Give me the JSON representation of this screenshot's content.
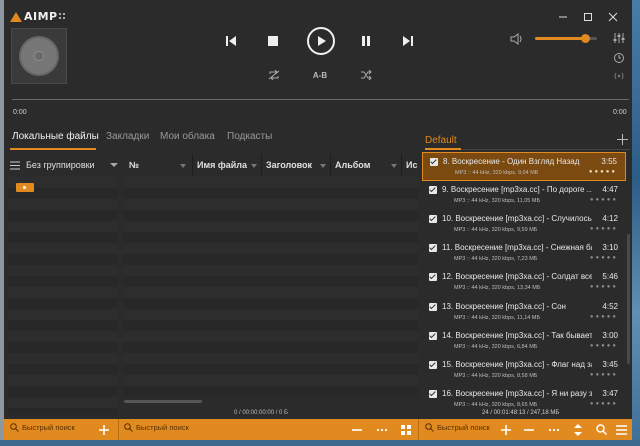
{
  "app": {
    "logo_text": "AIMP"
  },
  "player": {
    "time_elapsed": "0:00",
    "time_remaining": "0:00",
    "ab_label": "A-B",
    "volume": 0.8
  },
  "library": {
    "tabs": [
      {
        "label": "Локальные файлы",
        "active": true
      },
      {
        "label": "Закладки",
        "active": false
      },
      {
        "label": "Мои облака",
        "active": false
      },
      {
        "label": "Подкасты",
        "active": false
      }
    ],
    "grouping_label": "Без группировки",
    "columns": [
      "№",
      "Имя файла",
      "Заголовок",
      "Альбом",
      "Ис"
    ],
    "stats": "0 / 00:00:00:00 / 0 Б",
    "search_placeholder": "Быстрый поиск"
  },
  "playlist": {
    "tab_label": "Default",
    "tracks": [
      {
        "title": "8. Воскресение - Один Взгляд Назад",
        "duration": "3:55",
        "info": "MP3 :: 44 kHz, 320 kbps, 9,04 МБ",
        "active": true
      },
      {
        "title": "9. Воскресение [mp3xa.cc] - По дороге ...",
        "duration": "4:47",
        "info": "MP3 :: 44 kHz, 320 kbps, 11,05 МБ",
        "active": false
      },
      {
        "title": "10. Воскресение [mp3xa.cc] - Случилось",
        "duration": "4:12",
        "info": "MP3 :: 44 kHz, 320 kbps, 9,59 МБ",
        "active": false
      },
      {
        "title": "11. Воскресение [mp3xa.cc] - Снежная ба...",
        "duration": "3:10",
        "info": "MP3 :: 44 kHz, 320 kbps, 7,23 МБ",
        "active": false
      },
      {
        "title": "12. Воскресение [mp3xa.cc] - Солдат всел...",
        "duration": "5:46",
        "info": "MP3 :: 44 kHz, 320 kbps, 13,34 МБ",
        "active": false
      },
      {
        "title": "13. Воскресение [mp3xa.cc] - Сон",
        "duration": "4:52",
        "info": "MP3 :: 44 kHz, 320 kbps, 11,14 МБ",
        "active": false
      },
      {
        "title": "14. Воскресение [mp3xa.cc] - Так бывает",
        "duration": "3:00",
        "info": "MP3 :: 44 kHz, 320 kbps, 6,84 МБ",
        "active": false
      },
      {
        "title": "15. Воскресение [mp3xa.cc] - Флаг над за...",
        "duration": "3:45",
        "info": "MP3 :: 44 kHz, 320 kbps, 8,58 МБ",
        "active": false
      },
      {
        "title": "16. Воскресение [mp3xa.cc] - Я ни разу за...",
        "duration": "3:47",
        "info": "MP3 :: 44 kHz, 320 kbps, 8,65 МБ",
        "active": false
      }
    ],
    "stats": "24 / 00:01:48:13 / 247,18 МБ",
    "search_placeholder": "Быстрый поиск"
  },
  "colors": {
    "accent": "#e08a1f",
    "background": "#2b2b2b",
    "text": "#d6d6d6"
  },
  "icons": [
    "minimize-icon",
    "maximize-icon",
    "close-icon",
    "prev-icon",
    "stop-icon",
    "play-icon",
    "pause-icon",
    "next-icon",
    "repeat-icon",
    "shuffle-icon",
    "volume-icon",
    "equalizer-icon",
    "clock-icon",
    "radio-icon",
    "add-icon",
    "menu-icon",
    "search-icon",
    "grid-icon",
    "minus-icon",
    "more-icon",
    "sort-icon",
    "list-icon"
  ]
}
